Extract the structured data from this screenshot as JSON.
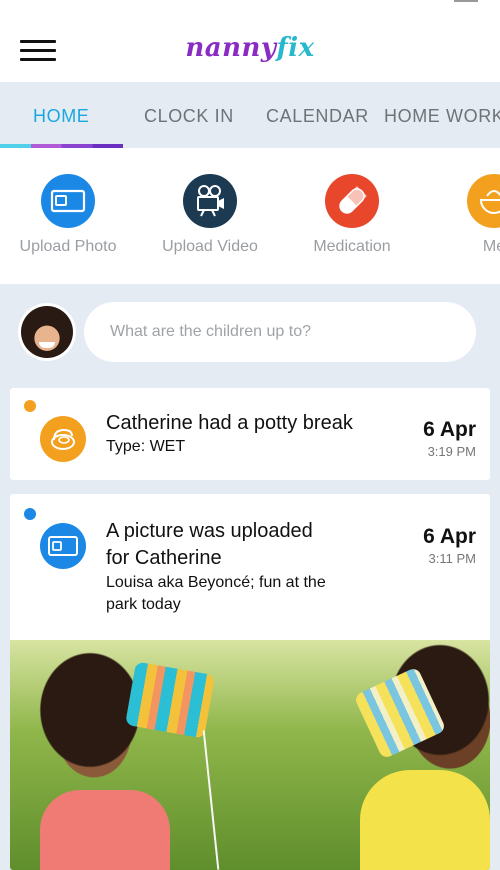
{
  "app": {
    "logo_part1": "nanny",
    "logo_part2": "fix",
    "colors": {
      "accent": "#1aa7e0",
      "logo_purple": "#8a2cc4",
      "logo_teal": "#27b8cc",
      "tab_bg": "#e4ebf2"
    }
  },
  "tabs": [
    {
      "label": "HOME",
      "active": true
    },
    {
      "label": "CLOCK IN",
      "active": false
    },
    {
      "label": "CALENDAR",
      "active": false
    },
    {
      "label": "HOME WORK",
      "active": false
    }
  ],
  "actions": [
    {
      "label": "Upload Photo",
      "icon": "camera-icon",
      "color": "#1b88e6"
    },
    {
      "label": "Upload Video",
      "icon": "video-camera-icon",
      "color": "#1d3a53"
    },
    {
      "label": "Medication",
      "icon": "pill-icon",
      "color": "#e8472c"
    },
    {
      "label": "Me",
      "icon": "meal-icon",
      "color": "#f3a01f"
    }
  ],
  "composer": {
    "placeholder": "What are the children up to?"
  },
  "feed": [
    {
      "title": "Catherine had a potty break",
      "subtitle": "Type: WET",
      "date": "6 Apr",
      "time": "3:19 PM",
      "icon": "potty-icon",
      "color": "#f3a01f"
    },
    {
      "title_line1": "A picture was uploaded",
      "title_line2": "for Catherine",
      "subtitle_line1": "Louisa aka Beyoncé; fun at the",
      "subtitle_line2": "park today",
      "date": "6 Apr",
      "time": "3:11 PM",
      "icon": "camera-icon",
      "color": "#1b88e6"
    }
  ]
}
